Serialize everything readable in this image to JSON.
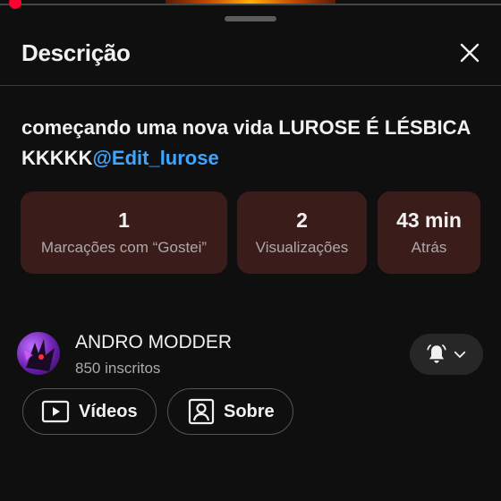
{
  "panel": {
    "title": "Descrição"
  },
  "description": {
    "text": "começando uma nova vida LUROSE É LÉSBICA KKKKK",
    "mention": "@Edit_lurose"
  },
  "stats": [
    {
      "value": "1",
      "label": "Marcações com “Gostei”"
    },
    {
      "value": "2",
      "label": "Visualizações"
    },
    {
      "value": "43 min",
      "label": "Atrás"
    }
  ],
  "channel": {
    "name": "ANDRO MODDER",
    "subscribers": "850 inscritos"
  },
  "buttons": {
    "videos": "Vídeos",
    "about": "Sobre"
  },
  "icons": {
    "close": "close-icon",
    "bell": "bell-icon",
    "chevron": "chevron-down-icon",
    "videos": "play-box-icon",
    "about": "portrait-icon"
  },
  "colors": {
    "background": "#0f0f0f",
    "stat_card": "#3a1d1a",
    "mention": "#3ea6ff",
    "scrubber": "#ff0033"
  }
}
